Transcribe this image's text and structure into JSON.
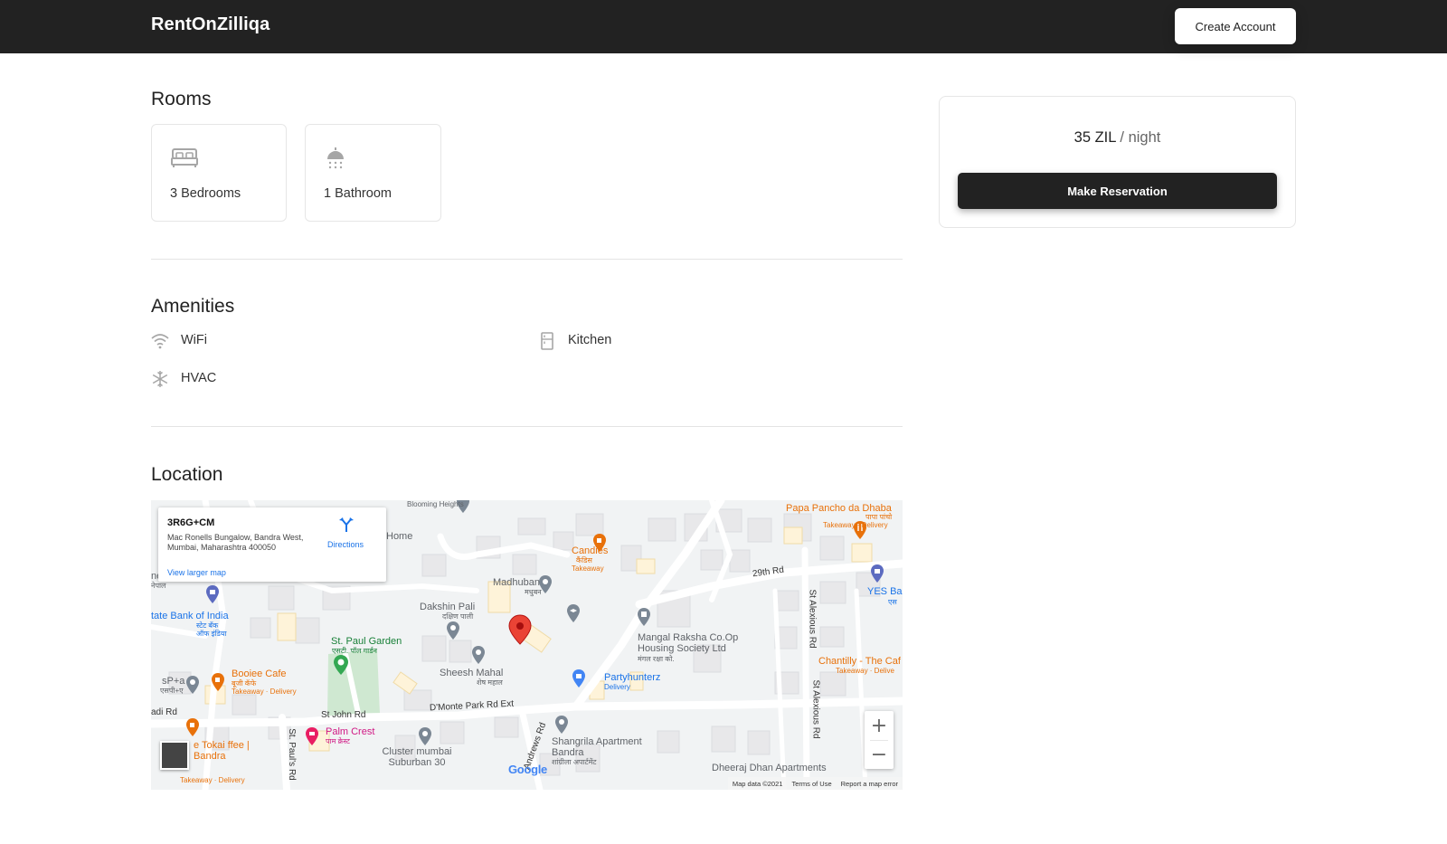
{
  "navbar": {
    "brand": "RentOnZilliqa",
    "create_account_label": "Create Account"
  },
  "rooms": {
    "title": "Rooms",
    "items": [
      {
        "icon": "bed-icon",
        "label": "3 Bedrooms"
      },
      {
        "icon": "shower-icon",
        "label": "1 Bathroom"
      }
    ]
  },
  "amenities": {
    "title": "Amenities",
    "items": [
      {
        "icon": "wifi-icon",
        "label": "WiFi"
      },
      {
        "icon": "kitchen-icon",
        "label": "Kitchen"
      },
      {
        "icon": "snowflake-icon",
        "label": "HVAC"
      }
    ]
  },
  "location": {
    "title": "Location",
    "map": {
      "plus_code": "3R6G+CM",
      "address": "Mac Ronells Bungalow, Bandra West, Mumbai, Maharashtra 400050",
      "directions_label": "Directions",
      "larger_map_label": "View larger map",
      "zoom_in": "+",
      "zoom_out": "−",
      "google_label": "Google",
      "footer": {
        "map_data": "Map data ©2021",
        "terms": "Terms of Use",
        "report": "Report a map error"
      },
      "labels": {
        "papa_pancho": "Papa Pancho da Dhaba",
        "papa_pancho_hi": "पापा पांचो",
        "papa_pancho_sub": "Takeaway · Delivery",
        "candies": "Candies",
        "candies_hi": "कैंडिस",
        "candies_sub": "Takeaway",
        "madhuban": "Madhuban",
        "madhuban_hi": "मधुबन",
        "road_29th": "29th Rd",
        "dakshin_pali": "Dakshin Pali",
        "dakshin_pali_hi": "दक्षिण पाली",
        "home": "Home",
        "blooming": "Blooming Heights",
        "sbi": "tate Bank of India",
        "sbi_hi": "स्टेट बँक ऑफ इंडिया",
        "st_paul_garden": "St. Paul Garden",
        "st_paul_garden_hi": "एसटी. पॉल गार्डन",
        "mangal_raksha": "Mangal Raksha Co.Op Housing Society Ltd",
        "mangal_raksha_hi": "मंगल रक्षा को.",
        "sheesh_mahal": "Sheesh Mahal",
        "sheesh_mahal_hi": "शेष महाल",
        "partyhunterz": "Partyhunterz",
        "partyhunterz_sub": "Delivery",
        "yes_bank": "YES Ba",
        "yes_bank_hi": "एस",
        "chantilly": "Chantilly - The Caf",
        "chantilly_sub": "Takeaway · Delive",
        "booiee": "Booiee Cafe",
        "booiee_hi": "बूजी कॅफे",
        "booiee_sub": "Takeaway · Delivery",
        "sp": "sP+a",
        "sp_hi": "एसपी+ए",
        "st_john": "St John Rd",
        "dmonte": "D'Monte Park Rd Ext",
        "andrews": "Andrews Rd",
        "st_alexious": "St Alexious Rd",
        "st_pauls": "St. Paul's Rd",
        "adi_rd": "adi Rd",
        "palm_crest": "Palm Crest",
        "palm_crest_hi": "पाम क्रेस्ट",
        "cluster": "Cluster mumbai Suburban 30",
        "shangrila": "Shangrila Apartment Bandra",
        "shangrila_hi": "शांग्रीला अपार्टमेंट",
        "tokai": "e Tokai ffee | Bandra",
        "tokai_sub": "Takeaway · Delivery",
        "dheeraj": "Dheeraj Dhan Apartments",
        "ne": "ne",
        "ne_hi": "नेपाल"
      }
    }
  },
  "reservation": {
    "price": "35 ZIL",
    "unit": " / night",
    "button_label": "Make Reservation"
  }
}
